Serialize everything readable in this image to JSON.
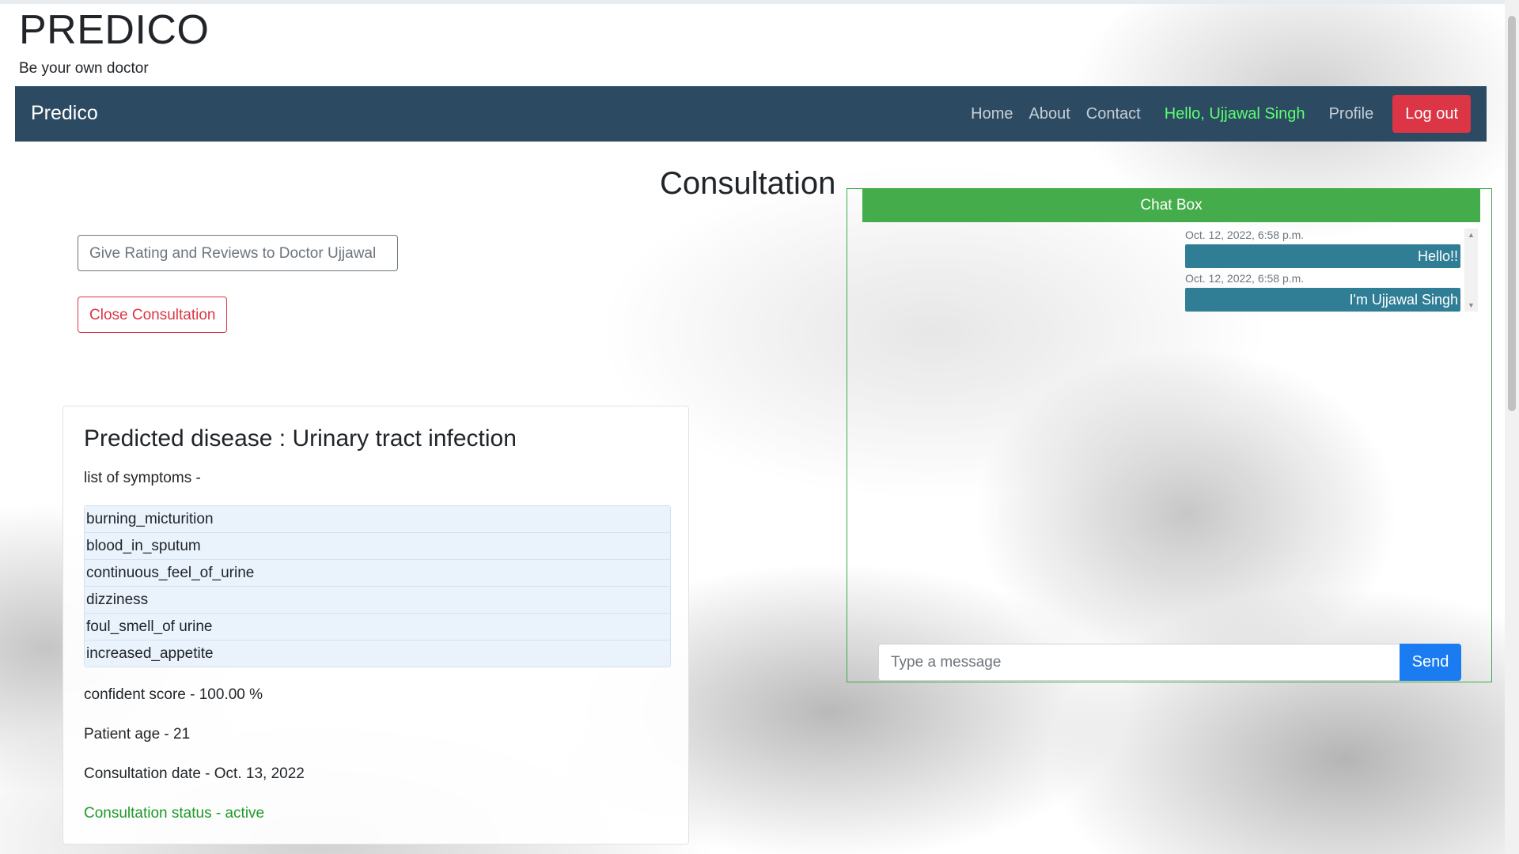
{
  "header": {
    "title": "PREDICO",
    "tagline": "Be your own doctor"
  },
  "navbar": {
    "brand": "Predico",
    "links": [
      "Home",
      "About",
      "Contact"
    ],
    "greeting": "Hello, Ujjawal Singh",
    "profile": "Profile",
    "logout": "Log out"
  },
  "page": {
    "title": "Consultation",
    "review_button": "Give Rating and Reviews to Doctor Ujjawal",
    "close_button": "Close Consultation"
  },
  "prediction": {
    "title": "Predicted disease : Urinary tract infection",
    "symptoms_label": "list of symptoms -",
    "symptoms": [
      "burning_micturition",
      "blood_in_sputum",
      "continuous_feel_of_urine",
      "dizziness",
      "foul_smell_of urine",
      "increased_appetite"
    ],
    "confidence": "confident score - 100.00 %",
    "age": "Patient age - 21",
    "date": "Consultation date - Oct. 13, 2022",
    "status": "Consultation status - active"
  },
  "chat": {
    "header": "Chat Box",
    "messages": [
      {
        "time": "Oct. 12, 2022, 6:58 p.m.",
        "text": "Hello!!"
      },
      {
        "time": "Oct. 12, 2022, 6:58 p.m.",
        "text": "I'm Ujjawal Singh"
      }
    ],
    "input_placeholder": "Type a message",
    "send_label": "Send"
  },
  "colors": {
    "navbar": "#2c4b63",
    "chat_header": "#44ac4a",
    "message_bubble": "#2f7e96",
    "logout": "#dc3545",
    "send": "#1b7cf2",
    "greeting": "#5cff70",
    "status": "#1f9a2a"
  }
}
